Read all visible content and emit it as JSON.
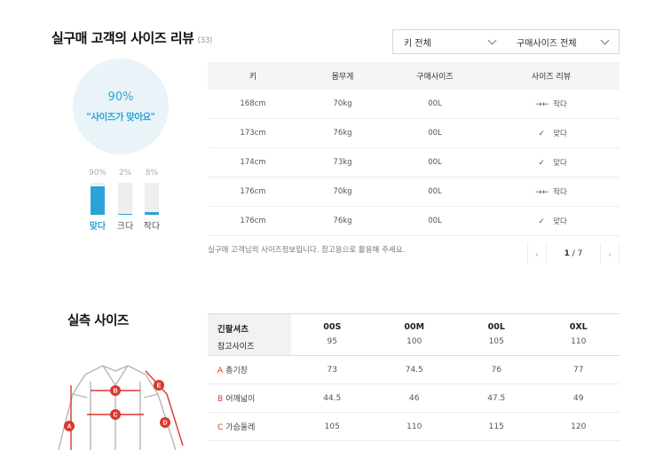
{
  "review": {
    "title": "실구매 고객의 사이즈 리뷰",
    "count": "(33)",
    "filters": [
      {
        "label": "키 전체"
      },
      {
        "label": "구매사이즈 전체"
      }
    ],
    "summary": {
      "percent": "90%",
      "label": "\"사이즈가 맞아요\""
    },
    "bars": [
      {
        "percent": "90%",
        "label": "맞다",
        "value": 0.9,
        "active": true
      },
      {
        "percent": "2%",
        "label": "크다",
        "value": 0.02,
        "active": false
      },
      {
        "percent": "8%",
        "label": "작다",
        "value": 0.08,
        "active": false
      }
    ],
    "table": {
      "headers": [
        "키",
        "몸무게",
        "구매사이즈",
        "사이즈 리뷰"
      ],
      "rows": [
        {
          "height": "168cm",
          "weight": "70kg",
          "size": "00L",
          "review": "작다",
          "icon": "arrows-in-icon"
        },
        {
          "height": "173cm",
          "weight": "76kg",
          "size": "00L",
          "review": "맞다",
          "icon": "check-icon"
        },
        {
          "height": "174cm",
          "weight": "73kg",
          "size": "00L",
          "review": "맞다",
          "icon": "check-icon"
        },
        {
          "height": "176cm",
          "weight": "70kg",
          "size": "00L",
          "review": "작다",
          "icon": "arrows-in-icon"
        },
        {
          "height": "176cm",
          "weight": "76kg",
          "size": "00L",
          "review": "맞다",
          "icon": "check-icon"
        }
      ]
    },
    "note": "실구매 고객님의 사이즈정보입니다. 참고용으로 활용해 주세요.",
    "pager": {
      "current": "1",
      "separator": "/",
      "total": "7"
    }
  },
  "measure": {
    "title": "실측 사이즈",
    "header": {
      "label1": "긴팔셔츠",
      "label2": "참고사이즈"
    },
    "columns": [
      {
        "size": "00S",
        "ref": "95"
      },
      {
        "size": "00M",
        "ref": "100"
      },
      {
        "size": "00L",
        "ref": "105"
      },
      {
        "size": "0XL",
        "ref": "110"
      }
    ],
    "rows": [
      {
        "letter": "A",
        "label": "총기장",
        "values": [
          "73",
          "74.5",
          "76",
          "77"
        ]
      },
      {
        "letter": "B",
        "label": "어깨넓이",
        "values": [
          "44.5",
          "46",
          "47.5",
          "49"
        ]
      },
      {
        "letter": "C",
        "label": "가슴둘레",
        "values": [
          "105",
          "110",
          "115",
          "120"
        ]
      }
    ],
    "diagram_labels": [
      "A",
      "B",
      "C",
      "D",
      "E"
    ],
    "accent_color": "#d9382f"
  },
  "colors": {
    "accent": "#2aa3d8",
    "circle_bg": "#eaf4f8",
    "measure_letter": "#d9382f"
  }
}
